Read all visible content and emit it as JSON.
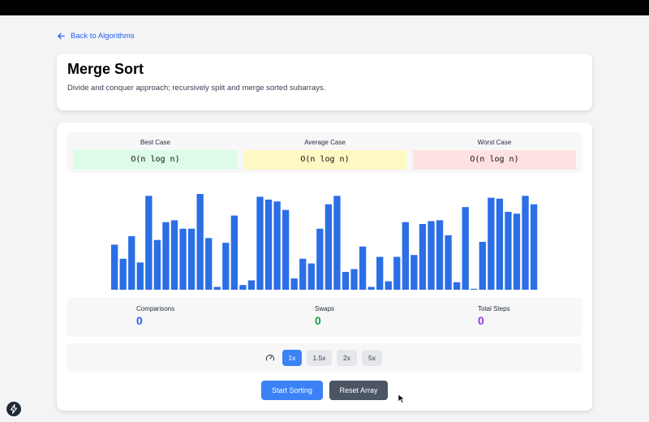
{
  "nav": {
    "back_label": "Back to Algorithms"
  },
  "header": {
    "title": "Merge Sort",
    "description": "Divide and conquer approach; recursively split and merge sorted subarrays."
  },
  "complexity": [
    {
      "label": "Best Case",
      "value": "O(n log n)",
      "color": "#dcfce7"
    },
    {
      "label": "Average Case",
      "value": "O(n log n)",
      "color": "#fef9c3"
    },
    {
      "label": "Worst Case",
      "value": "O(n log n)",
      "color": "#fee2e2"
    }
  ],
  "array": {
    "bar_color": "#2b6ee6",
    "max_value": 100,
    "values": [
      48,
      33,
      57,
      29,
      100,
      53,
      72,
      74,
      65,
      65,
      102,
      55,
      3,
      50,
      79,
      5,
      10,
      99,
      96,
      94,
      85,
      12,
      33,
      28,
      65,
      91,
      100,
      19,
      22,
      46,
      3,
      35,
      9,
      35,
      72,
      37,
      70,
      73,
      74,
      58,
      8,
      88,
      1,
      51,
      98,
      97,
      83,
      81,
      100,
      91
    ]
  },
  "stats": [
    {
      "label": "Comparisons",
      "value": "0",
      "color": "#2563eb"
    },
    {
      "label": "Swaps",
      "value": "0",
      "color": "#16a34a"
    },
    {
      "label": "Total Steps",
      "value": "0",
      "color": "#9333ea"
    }
  ],
  "speed": {
    "icon": "gauge-icon",
    "options": [
      "1x",
      "1.5x",
      "2x",
      "5x"
    ],
    "selected": "1x"
  },
  "actions": {
    "start_label": "Start Sorting",
    "reset_label": "Reset Array",
    "start_color": "#3b82f6",
    "reset_color": "#4b5563"
  }
}
